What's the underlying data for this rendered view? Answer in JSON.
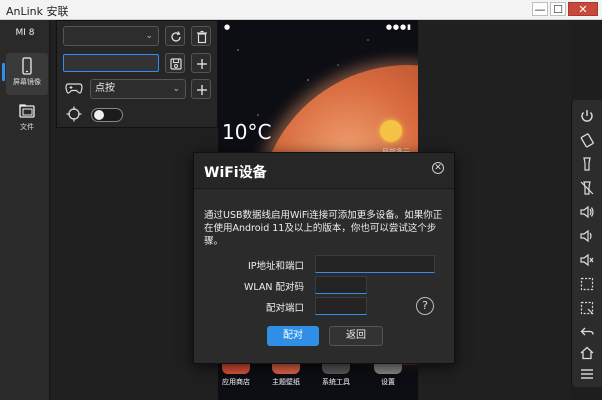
{
  "window": {
    "title": "AnLink 安联",
    "min_glyph": "—",
    "max_glyph": "☐",
    "close_glyph": "✕"
  },
  "sidebar": {
    "device_name": "MI 8",
    "items": [
      {
        "label": "屏幕镜像",
        "icon": "phone-icon",
        "active": true
      },
      {
        "label": "文件",
        "icon": "folder-icon",
        "active": false
      }
    ]
  },
  "keymap_panel": {
    "profile_select_value": "",
    "name_input_value": "",
    "key_type_select_value": "点按",
    "toggle_on": false
  },
  "phone_screen": {
    "temperature": "10°C",
    "weather_label": "局部多云",
    "dock_apps": [
      {
        "label": "应用商店"
      },
      {
        "label": "主题壁纸"
      },
      {
        "label": "系统工具"
      },
      {
        "label": "设置"
      }
    ]
  },
  "toolbar": {
    "buttons": [
      "power-icon",
      "rotate-icon",
      "flashlight-icon",
      "flashlight-off-icon",
      "volume-up-icon",
      "volume-down-icon",
      "mute-icon",
      "screenshot-icon",
      "screen-record-icon",
      "back-icon",
      "home-icon",
      "menu-icon"
    ]
  },
  "wifi_dialog": {
    "title": "WiFi设备",
    "description": "通过USB数据线启用WiFi连接可添加更多设备。如果你正在使用Android 11及以上的版本，你也可以尝试这个步骤。",
    "ip_port_label": "IP地址和端口",
    "ip_port_value": "",
    "pair_code_label": "WLAN 配对码",
    "pair_code_value": "",
    "pair_port_label": "配对端口",
    "pair_port_value": "",
    "help_glyph": "?",
    "pair_button": "配对",
    "back_button": "返回",
    "close_glyph": "✕"
  },
  "colors": {
    "accent": "#2f8ff0",
    "primary_button": "#2f8fe6",
    "close_button": "#c9483c"
  }
}
